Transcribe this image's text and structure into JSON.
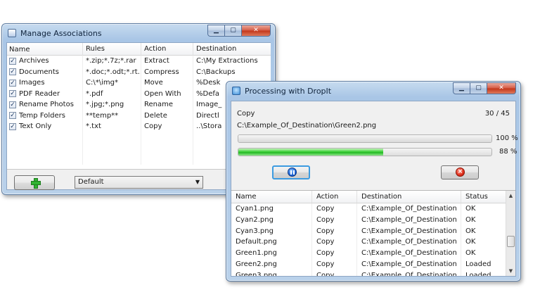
{
  "associations_window": {
    "title": "Manage Associations",
    "controls": {
      "minimize": "▁",
      "maximize": "▢",
      "close": "✕"
    },
    "columns": [
      "Name",
      "Rules",
      "Action",
      "Destination"
    ],
    "rows": [
      {
        "name": "Archives",
        "rules": "*.zip;*.7z;*.rar",
        "action": "Extract",
        "destination": "C:\\My Extractions",
        "checked": true
      },
      {
        "name": "Documents",
        "rules": "*.doc;*.odt;*.rt...",
        "action": "Compress",
        "destination": "C:\\Backups",
        "checked": true
      },
      {
        "name": "Images",
        "rules": "C:\\*\\img*",
        "action": "Move",
        "destination": "%Desk",
        "checked": true
      },
      {
        "name": "PDF Reader",
        "rules": "*.pdf",
        "action": "Open With",
        "destination": "%Defa",
        "checked": true
      },
      {
        "name": "Rename Photos",
        "rules": "*.jpg;*.png",
        "action": "Rename",
        "destination": "Image_",
        "checked": true
      },
      {
        "name": "Temp Folders",
        "rules": "**temp**",
        "action": "Delete",
        "destination": "Directl",
        "checked": true
      },
      {
        "name": "Text Only",
        "rules": "*.txt",
        "action": "Copy",
        "destination": "..\\Stora",
        "checked": true
      }
    ],
    "profile_select": "Default"
  },
  "processing_window": {
    "title": "Processing with DropIt",
    "controls": {
      "minimize": "▁",
      "maximize": "▢",
      "close": "✕"
    },
    "action_label": "Copy",
    "count": "30 / 45",
    "current_file": "C:\\Example_Of_Destination\\Green2.png",
    "progress_total": {
      "label": "100 %",
      "fraction": 1.0
    },
    "progress_file": {
      "label": "88 %",
      "fraction": 0.88
    },
    "columns": [
      "Name",
      "Action",
      "Destination",
      "Status"
    ],
    "rows": [
      {
        "name": "Cyan1.png",
        "action": "Copy",
        "destination": "C:\\Example_Of_Destination",
        "status": "OK"
      },
      {
        "name": "Cyan2.png",
        "action": "Copy",
        "destination": "C:\\Example_Of_Destination",
        "status": "OK"
      },
      {
        "name": "Cyan3.png",
        "action": "Copy",
        "destination": "C:\\Example_Of_Destination",
        "status": "OK"
      },
      {
        "name": "Default.png",
        "action": "Copy",
        "destination": "C:\\Example_Of_Destination",
        "status": "OK"
      },
      {
        "name": "Green1.png",
        "action": "Copy",
        "destination": "C:\\Example_Of_Destination",
        "status": "OK"
      },
      {
        "name": "Green2.png",
        "action": "Copy",
        "destination": "C:\\Example_Of_Destination",
        "status": "Loaded"
      },
      {
        "name": "Green3.png",
        "action": "Copy",
        "destination": "C:\\Example_Of_Destination",
        "status": "Loaded"
      }
    ]
  }
}
